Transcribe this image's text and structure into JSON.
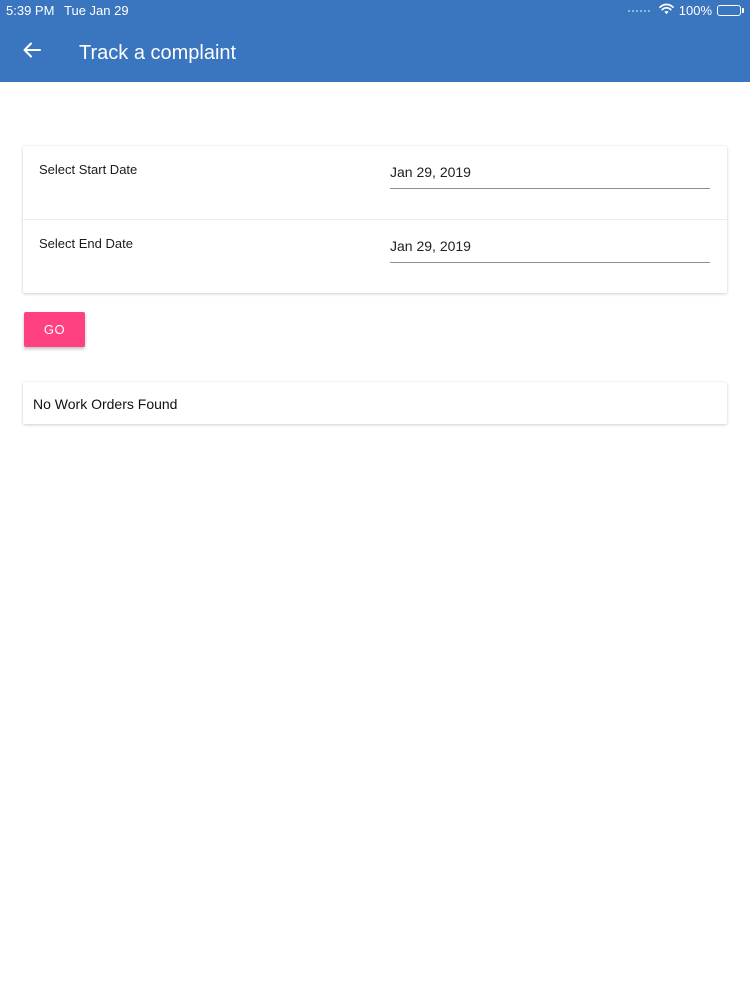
{
  "status_bar": {
    "time": "5:39 PM",
    "date": "Tue Jan 29",
    "battery": "100%",
    "icons": [
      "signal-dots-icon",
      "wifi-icon",
      "battery-icon"
    ]
  },
  "header": {
    "title": "Track a complaint",
    "back_icon": "arrow-left-icon",
    "background_color": "#3a75bf"
  },
  "date_filter": {
    "start_label": "Select Start Date",
    "start_value": "Jan 29, 2019",
    "end_label": "Select End Date",
    "end_value": "Jan 29, 2019"
  },
  "actions": {
    "go_label": "GO",
    "go_color": "#ff4081"
  },
  "results": {
    "message": "No Work Orders Found"
  }
}
